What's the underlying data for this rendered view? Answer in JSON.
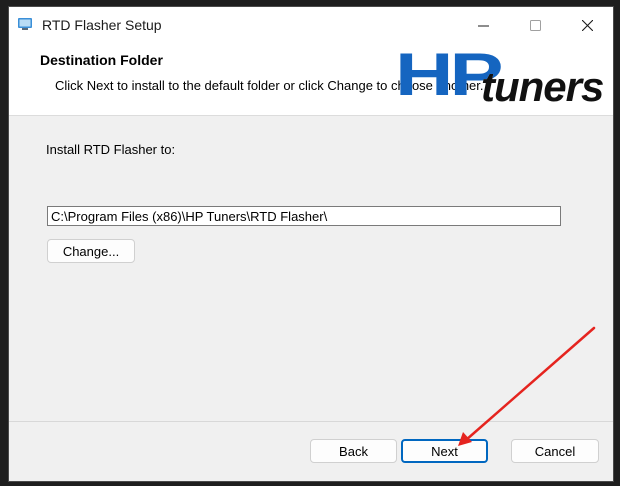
{
  "window": {
    "title": "RTD Flasher Setup",
    "controls": {
      "minimize": "minimize-icon",
      "maximize": "maximize-icon",
      "close": "close-icon"
    }
  },
  "header": {
    "title": "Destination Folder",
    "description": "Click Next to install to the default folder or click Change to choose another.",
    "logo": {
      "hp": "HP",
      "tuners": "tuners",
      "hp_color": "#1565c0",
      "tuners_color": "#111111"
    }
  },
  "main": {
    "install_label": "Install RTD Flasher to:",
    "install_path": "C:\\Program Files (x86)\\HP Tuners\\RTD Flasher\\",
    "change_button": "Change..."
  },
  "footer": {
    "back_button": "Back",
    "next_button": "Next",
    "cancel_button": "Cancel"
  },
  "annotation": {
    "color": "#e5241f",
    "target": "next-button"
  },
  "colors": {
    "accent": "#0067c0",
    "dialog_bg": "#f0f0f0"
  }
}
